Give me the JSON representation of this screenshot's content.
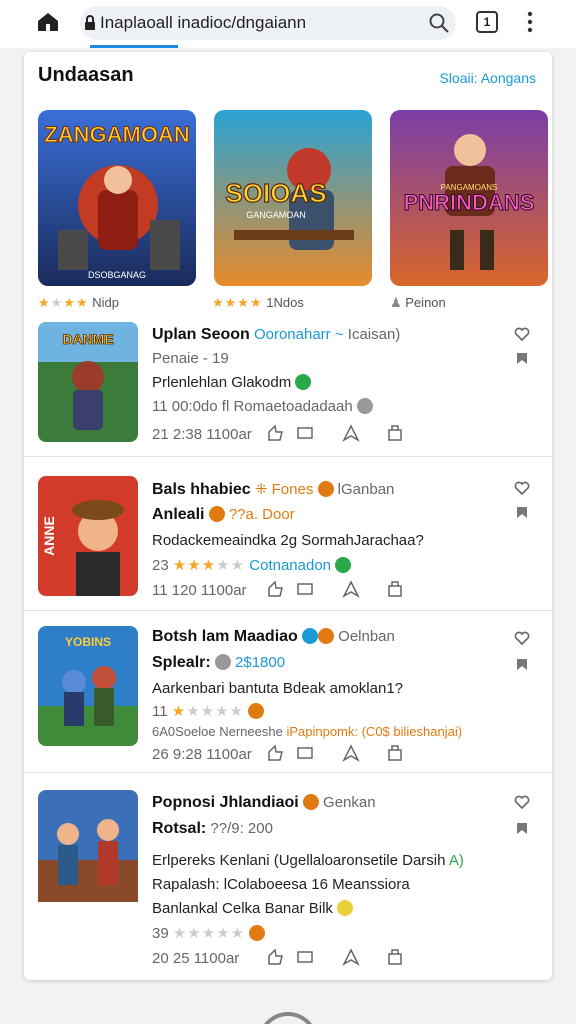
{
  "browser": {
    "url": "Inaplaoall inadioc/dngaiann",
    "tabs_count": "1"
  },
  "section": {
    "title": "Undaasan",
    "link": "Sloaii: Aongans"
  },
  "featured": [
    {
      "art_title": "ZANGAMOAN",
      "caption": "DSOBGANAG",
      "meta": "Nidp",
      "stars": 3
    },
    {
      "art_title": "SOIOAS",
      "caption": "GANGAMOAN",
      "meta": "1Ndos",
      "stars": 4
    },
    {
      "art_title": "PNRINDANS",
      "caption": "PANGAMOANS",
      "meta": "Peinon",
      "stars": 0
    }
  ],
  "rows": [
    {
      "art_title": "DANME",
      "title": "Uplan Seoon",
      "tag": "Ooronaharr",
      "tag2": "Icaisan)",
      "line2": "Penaie - 19",
      "line3": "Prlenlehlan Glakodm",
      "line4": "11 00:0do fl Romaetoadadaah",
      "footer": "21 2:38 1100ar"
    },
    {
      "art_title": "ANNE",
      "title": "Bals hhabiec",
      "tag": "Fones",
      "tag2": "lGanban",
      "line2_label": "Anleali",
      "line2_value": "??a. Door",
      "line3": "Rodackemeaindka 2g SormahJarachaa?",
      "line4_num": "23",
      "line4_tag": "Cotnanadon",
      "footer": "11 120 1100ar"
    },
    {
      "art_title": "YOBINS",
      "title": "Botsh lam Maadiao",
      "tag": "Oelnban",
      "line2_label": "Splealr:",
      "line2_value": "2$1800",
      "line3": "Aarkenbari bantuta Bdeak amoklan1?",
      "line4_num": "11",
      "line5_a": "6A0Soeloe Nerneeshe",
      "line5_b": "iPapinpomk: (C0$ bilieshanjai)",
      "footer": "26 9:28 1100ar"
    },
    {
      "art_title": "",
      "title": "Popnosi Jhlandiaoi",
      "tag": "Genkan",
      "line2_label": "Rotsal:",
      "line2_value": "??/9: 200",
      "line3": "Erlpereks Kenlani (Ugellaloaronsetile Darsih",
      "line3_tag": "A)",
      "line4": "Rapalash: lColaboeesa 16 Meanssiora",
      "line5": "Banlankal Celka Banar Bilk",
      "line6_num": "39",
      "footer": "20 25 1100ar"
    }
  ],
  "colors": {
    "accent": "#1e88e5",
    "link": "#1a9ad6",
    "star": "#f5a623",
    "orange": "#e07b12",
    "green": "#2aa84a"
  },
  "icons": [
    "home-icon",
    "lock-icon",
    "search-icon",
    "tabs-icon",
    "menu-dots-icon",
    "heart-icon",
    "bookmark-icon",
    "thumbs-up-icon",
    "chat-icon",
    "share-icon",
    "save-icon"
  ]
}
